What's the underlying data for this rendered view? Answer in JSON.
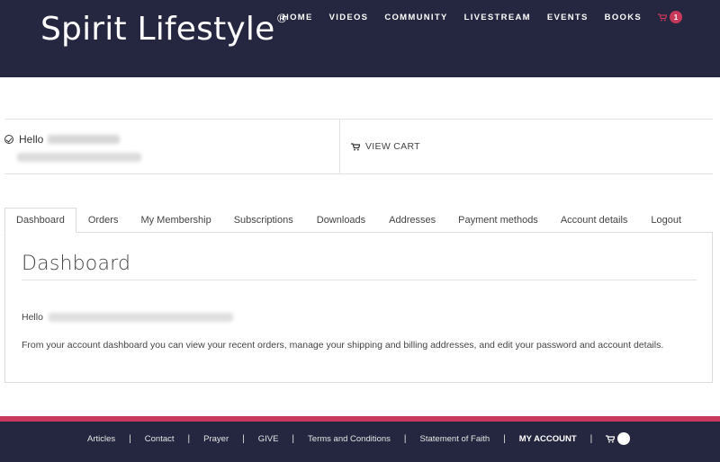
{
  "header": {
    "logo_text": "Spirit Lifestyle",
    "logo_mark": "®",
    "nav": [
      "HOME",
      "VIDEOS",
      "COMMUNITY",
      "LIVESTREAM",
      "EVENTS",
      "BOOKS"
    ],
    "cart_count": "1",
    "cart_icon": "cart-icon",
    "colors": {
      "background": "#24273f",
      "badge": "#c8385a"
    }
  },
  "account_panel": {
    "greeting": "Hello",
    "view_cart_label": "VIEW CART",
    "check_icon": "check-circle-icon"
  },
  "tabs": [
    "Dashboard",
    "Orders",
    "My Membership",
    "Subscriptions",
    "Downloads",
    "Addresses",
    "Payment methods",
    "Account details",
    "Logout"
  ],
  "active_tab": "Dashboard",
  "content": {
    "title": "Dashboard",
    "greeting": "Hello",
    "description": "From your account dashboard you can view your recent orders, manage your shipping and billing addresses, and edit your password and account details."
  },
  "footer": {
    "links": [
      "Articles",
      "Contact",
      "Prayer",
      "GIVE",
      "Terms and Conditions",
      "Statement of Faith",
      "MY ACCOUNT"
    ],
    "separator": "|",
    "cart_count": "",
    "colors": {
      "stripe": "#c8385a",
      "background": "#24273f"
    }
  }
}
